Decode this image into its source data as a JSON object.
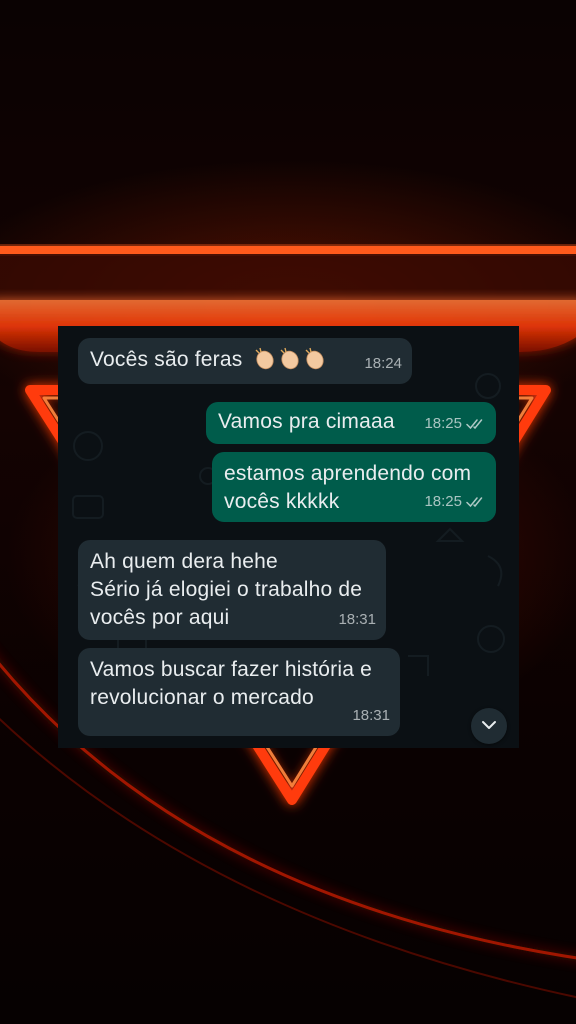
{
  "messages": [
    {
      "direction": "in",
      "text": "Vocês são feras",
      "emoji": "clapping-hands-icon",
      "time": "18:24"
    },
    {
      "direction": "out",
      "text": "Vamos pra cimaaa",
      "time": "18:25",
      "status": "read"
    },
    {
      "direction": "out",
      "text": "estamos aprendendo com\nvocês kkkkk",
      "time": "18:25",
      "status": "read"
    },
    {
      "direction": "in",
      "text": "Ah quem dera hehe\nSério já elogiei o trabalho de\nvocês por aqui",
      "time": "18:31"
    },
    {
      "direction": "in",
      "text": "Vamos buscar fazer história e\nrevolucionar o mercado",
      "time": "18:31"
    }
  ],
  "scroll_button_icon": "chevron-down-icon",
  "colors": {
    "incoming_bubble": "#202c33",
    "outgoing_bubble": "#005c4b",
    "chat_background": "#0b1014",
    "neon_accent": "#ff4a12"
  }
}
